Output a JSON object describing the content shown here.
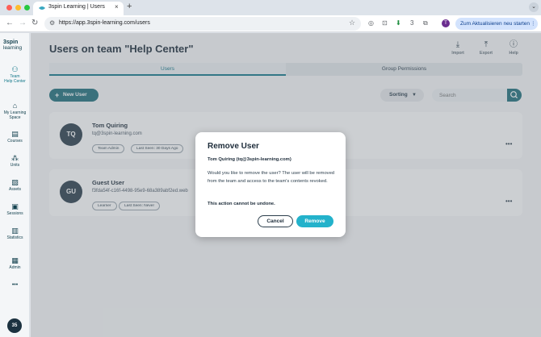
{
  "browser": {
    "tab_title": "3spin Learning | Users",
    "tab_close": "×",
    "new_tab": "+",
    "tab_menu": "⌄",
    "url": "https://app.3spin-learning.com/users",
    "update_button": "Zum Aktualisieren neu starten",
    "profile_initial": "T",
    "ext_badge": "3",
    "colors": {
      "traffic_red": "#ff5f57",
      "traffic_yellow": "#febc2e",
      "traffic_green": "#28c840"
    }
  },
  "sidebar": {
    "logo_top": "3spin",
    "logo_bottom": "learning",
    "items": [
      {
        "label1": "Team",
        "label2": "Help Center",
        "icon": "team-icon"
      },
      {
        "label1": "My Learning",
        "label2": "Space",
        "icon": "home-icon"
      },
      {
        "label1": "Courses",
        "label2": "",
        "icon": "courses-icon"
      },
      {
        "label1": "Units",
        "label2": "",
        "icon": "units-icon"
      },
      {
        "label1": "Assets",
        "label2": "",
        "icon": "assets-icon"
      },
      {
        "label1": "Sessions",
        "label2": "",
        "icon": "sessions-icon"
      },
      {
        "label1": "Statistics",
        "label2": "",
        "icon": "statistics-icon"
      },
      {
        "label1": "Admin",
        "label2": "",
        "icon": "admin-icon"
      }
    ],
    "more": "•••",
    "user_avatar": "35"
  },
  "page": {
    "title": "Users on team \"Help Center\"",
    "toolbar": {
      "import": "Import",
      "export": "Export",
      "help": "Help"
    },
    "tabs": [
      "Users",
      "Group Permissions"
    ],
    "new_user_label": "New User",
    "sorting_label": "Sorting",
    "search_placeholder": "Search"
  },
  "users": [
    {
      "initials": "TQ",
      "name": "Tom Quiring",
      "email": "tq@3spin-learning.com",
      "chips": [
        "Team Admin",
        "Last Seen: 30 Days Ago"
      ]
    },
    {
      "initials": "GU",
      "name": "Guest User",
      "email": "f3fda54f-c16f-4498-95e9-68a389abf2ed.web",
      "chips": [
        "Learner",
        "Last Seen: Never"
      ]
    }
  ],
  "modal": {
    "title": "Remove User",
    "subtitle": "Tom Quiring (tq@3spin-learning.com)",
    "body": "Would you like to remove the user? The user will be removed from the team and access to the team's contents revoked.",
    "warning": "This action cannot be undone.",
    "cancel": "Cancel",
    "remove": "Remove"
  }
}
